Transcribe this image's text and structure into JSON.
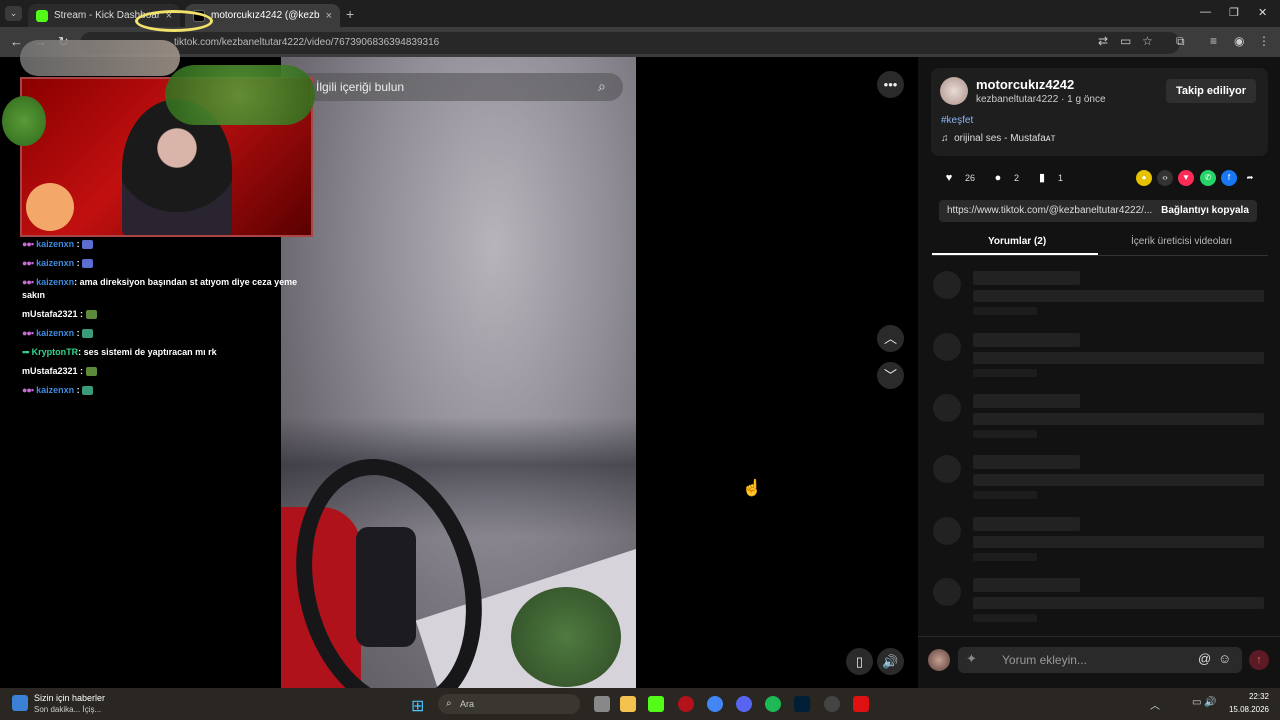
{
  "browser": {
    "tabs": [
      {
        "label": "Stream - Kick Dashboard",
        "close": "×"
      },
      {
        "label": "motorcukız4242 (@kezbane",
        "close": "×"
      }
    ],
    "new_tab": "+",
    "tab_menu": "⌄",
    "url_host": "tiktok.com/",
    "url_path": "kezbaneltutar4222/video/7673906836394839316",
    "window_controls": {
      "minimize": "—",
      "restore": "❐",
      "close": "✕"
    }
  },
  "video": {
    "search_placeholder": "İlgili içeriği bulun",
    "more": "•••",
    "nav_up": "︿",
    "nav_down": "﹀",
    "mobile_icon": "▯",
    "volume_icon": "🔊"
  },
  "stream_chat": {
    "lines": [
      {
        "user": "kaizenxn",
        "msg": "",
        "color": "#3d8be0"
      },
      {
        "user": "kaizenxn",
        "msg": "",
        "color": "#3d8be0"
      },
      {
        "user": "kaizenxn",
        "msg": ": ama direksiyon başından st atıyom diye ceza yeme sakın",
        "color": "#3d8be0"
      },
      {
        "user": "mUstafa2321",
        "msg": "",
        "color": "#ffffff"
      },
      {
        "user": "kaizenxn",
        "msg": "",
        "color": "#3d8be0"
      },
      {
        "user": "KryptonTR",
        "msg": ": ses sistemi de yaptıracan mı rk",
        "color": "#38d48c"
      },
      {
        "user": "mUstafa2321",
        "msg": "",
        "color": "#ffffff"
      },
      {
        "user": "kaizenxn",
        "msg": "",
        "color": "#3d8be0"
      }
    ]
  },
  "panel": {
    "author": "motorcukız4242",
    "author_meta": "kezbaneltutar4222 · 1 g önce",
    "follow_label": "Takip ediliyor",
    "hashtag": "#keşfet",
    "music": "orijinal ses - Mustafaᴀᴛ",
    "likes": "26",
    "comments": "2",
    "saves": "1",
    "link": "https://www.tiktok.com/@kezbaneltutar4222/...",
    "copy_label": "Bağlantıyı kopyala",
    "tab_comments": "Yorumlar (2)",
    "tab_creator": "İçerik üreticisi videoları",
    "comment_placeholder": "Yorum ekleyin...",
    "at": "@",
    "smile": "☺",
    "send": "↑"
  },
  "taskbar": {
    "news_title": "Sizin için haberler",
    "news_sub": "Son dakika... İçiş...",
    "search_label": "Ara",
    "time": "22:32",
    "date": "15.08.2026",
    "start_icon": "⊞",
    "tray_up": "︿",
    "tray_icons": "▭ 🔊"
  },
  "colors": {
    "accent_link": "#8ab4f8",
    "tiktok_red": "#fe2c55"
  }
}
